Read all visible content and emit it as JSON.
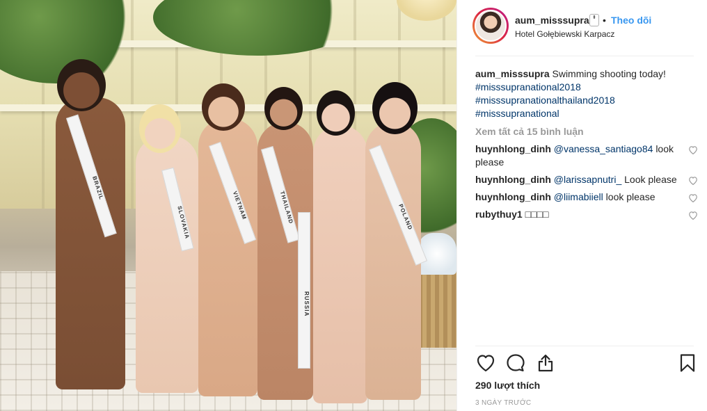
{
  "post": {
    "username": "aum_misssupra",
    "verified_glyph": "⬍",
    "separator": "•",
    "follow_label": "Theo dõi",
    "location": "Hotel Gołębiewski Karpacz",
    "caption_user": "aum_misssupra",
    "caption_text": "Swimming shooting today!",
    "hashtags": [
      "#misssupranational2018",
      "#misssupranationalthailand2018",
      "#misssupranational"
    ],
    "view_all_comments": "Xem tất cả 15 bình luận",
    "comments": [
      {
        "user": "huynhlong_dinh",
        "mention": "@vanessa_santiago84",
        "text": "look please"
      },
      {
        "user": "huynhlong_dinh",
        "mention": "@larissapnutri_",
        "text": "Look please"
      },
      {
        "user": "huynhlong_dinh",
        "mention": "@liimabiiell",
        "text": "look please"
      },
      {
        "user": "rubythuy1",
        "mention": "",
        "text": "□□□□"
      }
    ],
    "likes": "290 lượt thích",
    "time_ago": "3 NGÀY TRƯỚC"
  },
  "photo": {
    "sash_labels": [
      "BRAZIL",
      "SLOVAKIA",
      "VIETNAM",
      "THAILAND",
      "RUSSIA",
      "POLAND"
    ]
  },
  "icons": {
    "like": "heart-icon",
    "comment": "comment-icon",
    "share": "share-icon",
    "save": "bookmark-icon",
    "comment_like": "heart-icon"
  },
  "colors": {
    "link": "#3897f0",
    "hashtag": "#003569",
    "muted": "#999999",
    "text": "#262626"
  }
}
